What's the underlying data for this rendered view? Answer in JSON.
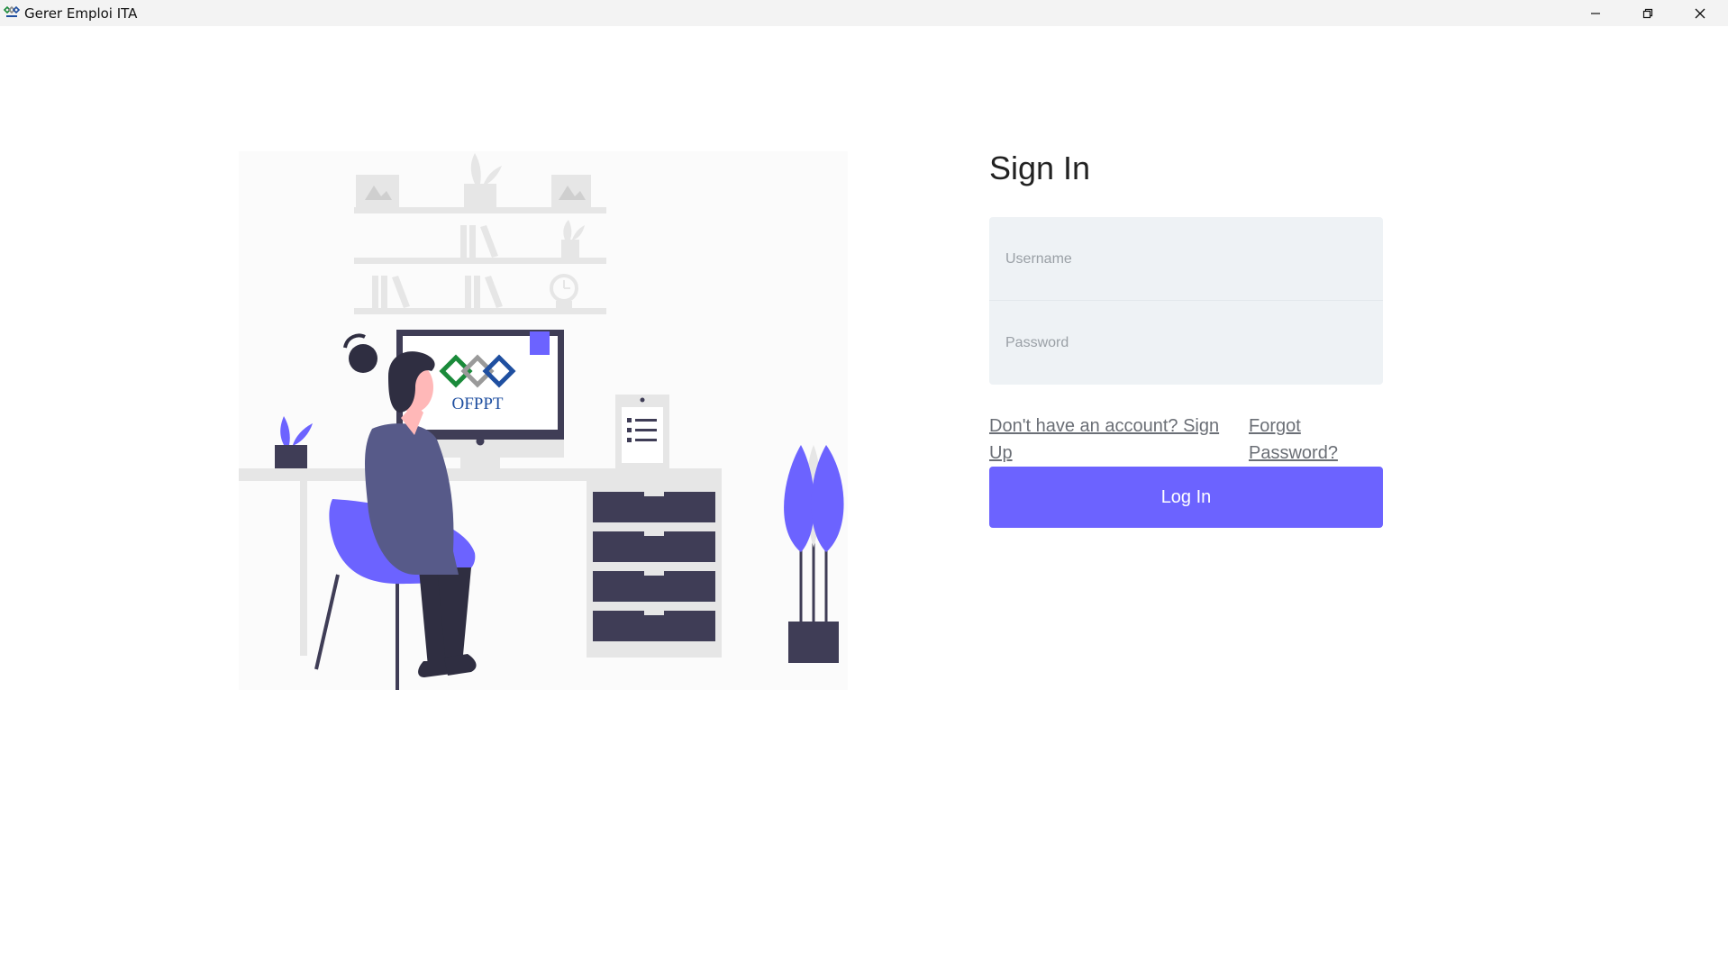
{
  "window": {
    "title": "Gerer Emploi ITA",
    "controls": [
      "minimize",
      "restore",
      "close"
    ]
  },
  "illustration": {
    "monitor_logo_text": "OFPPT",
    "accent_color": "#6c63ff",
    "dark_color": "#3f3d56"
  },
  "signin": {
    "heading": "Sign In",
    "username_placeholder": "Username",
    "password_placeholder": "Password",
    "signup_link": "Don't have an account? Sign Up",
    "forgot_link": "Forgot Password?",
    "login_button": "Log In",
    "button_color": "#6c63ff"
  }
}
